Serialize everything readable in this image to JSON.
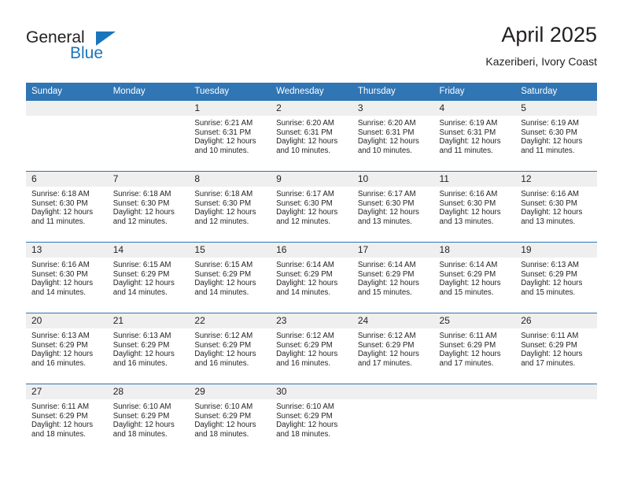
{
  "logo": {
    "word1": "General",
    "word2": "Blue",
    "shape": "triangle-mark"
  },
  "header": {
    "title": "April 2025",
    "subtitle": "Kazeriberi, Ivory Coast"
  },
  "colors": {
    "header_blue": "#3075b4",
    "logo_blue": "#1b75bb",
    "daynum_band": "#efefef",
    "text": "#231f20"
  },
  "weekdays": [
    "Sunday",
    "Monday",
    "Tuesday",
    "Wednesday",
    "Thursday",
    "Friday",
    "Saturday"
  ],
  "weeks": [
    [
      {
        "day": "",
        "lines": []
      },
      {
        "day": "",
        "lines": []
      },
      {
        "day": "1",
        "lines": [
          "Sunrise: 6:21 AM",
          "Sunset: 6:31 PM",
          "Daylight: 12 hours",
          "and 10 minutes."
        ]
      },
      {
        "day": "2",
        "lines": [
          "Sunrise: 6:20 AM",
          "Sunset: 6:31 PM",
          "Daylight: 12 hours",
          "and 10 minutes."
        ]
      },
      {
        "day": "3",
        "lines": [
          "Sunrise: 6:20 AM",
          "Sunset: 6:31 PM",
          "Daylight: 12 hours",
          "and 10 minutes."
        ]
      },
      {
        "day": "4",
        "lines": [
          "Sunrise: 6:19 AM",
          "Sunset: 6:31 PM",
          "Daylight: 12 hours",
          "and 11 minutes."
        ]
      },
      {
        "day": "5",
        "lines": [
          "Sunrise: 6:19 AM",
          "Sunset: 6:30 PM",
          "Daylight: 12 hours",
          "and 11 minutes."
        ]
      }
    ],
    [
      {
        "day": "6",
        "lines": [
          "Sunrise: 6:18 AM",
          "Sunset: 6:30 PM",
          "Daylight: 12 hours",
          "and 11 minutes."
        ]
      },
      {
        "day": "7",
        "lines": [
          "Sunrise: 6:18 AM",
          "Sunset: 6:30 PM",
          "Daylight: 12 hours",
          "and 12 minutes."
        ]
      },
      {
        "day": "8",
        "lines": [
          "Sunrise: 6:18 AM",
          "Sunset: 6:30 PM",
          "Daylight: 12 hours",
          "and 12 minutes."
        ]
      },
      {
        "day": "9",
        "lines": [
          "Sunrise: 6:17 AM",
          "Sunset: 6:30 PM",
          "Daylight: 12 hours",
          "and 12 minutes."
        ]
      },
      {
        "day": "10",
        "lines": [
          "Sunrise: 6:17 AM",
          "Sunset: 6:30 PM",
          "Daylight: 12 hours",
          "and 13 minutes."
        ]
      },
      {
        "day": "11",
        "lines": [
          "Sunrise: 6:16 AM",
          "Sunset: 6:30 PM",
          "Daylight: 12 hours",
          "and 13 minutes."
        ]
      },
      {
        "day": "12",
        "lines": [
          "Sunrise: 6:16 AM",
          "Sunset: 6:30 PM",
          "Daylight: 12 hours",
          "and 13 minutes."
        ]
      }
    ],
    [
      {
        "day": "13",
        "lines": [
          "Sunrise: 6:16 AM",
          "Sunset: 6:30 PM",
          "Daylight: 12 hours",
          "and 14 minutes."
        ]
      },
      {
        "day": "14",
        "lines": [
          "Sunrise: 6:15 AM",
          "Sunset: 6:29 PM",
          "Daylight: 12 hours",
          "and 14 minutes."
        ]
      },
      {
        "day": "15",
        "lines": [
          "Sunrise: 6:15 AM",
          "Sunset: 6:29 PM",
          "Daylight: 12 hours",
          "and 14 minutes."
        ]
      },
      {
        "day": "16",
        "lines": [
          "Sunrise: 6:14 AM",
          "Sunset: 6:29 PM",
          "Daylight: 12 hours",
          "and 14 minutes."
        ]
      },
      {
        "day": "17",
        "lines": [
          "Sunrise: 6:14 AM",
          "Sunset: 6:29 PM",
          "Daylight: 12 hours",
          "and 15 minutes."
        ]
      },
      {
        "day": "18",
        "lines": [
          "Sunrise: 6:14 AM",
          "Sunset: 6:29 PM",
          "Daylight: 12 hours",
          "and 15 minutes."
        ]
      },
      {
        "day": "19",
        "lines": [
          "Sunrise: 6:13 AM",
          "Sunset: 6:29 PM",
          "Daylight: 12 hours",
          "and 15 minutes."
        ]
      }
    ],
    [
      {
        "day": "20",
        "lines": [
          "Sunrise: 6:13 AM",
          "Sunset: 6:29 PM",
          "Daylight: 12 hours",
          "and 16 minutes."
        ]
      },
      {
        "day": "21",
        "lines": [
          "Sunrise: 6:13 AM",
          "Sunset: 6:29 PM",
          "Daylight: 12 hours",
          "and 16 minutes."
        ]
      },
      {
        "day": "22",
        "lines": [
          "Sunrise: 6:12 AM",
          "Sunset: 6:29 PM",
          "Daylight: 12 hours",
          "and 16 minutes."
        ]
      },
      {
        "day": "23",
        "lines": [
          "Sunrise: 6:12 AM",
          "Sunset: 6:29 PM",
          "Daylight: 12 hours",
          "and 16 minutes."
        ]
      },
      {
        "day": "24",
        "lines": [
          "Sunrise: 6:12 AM",
          "Sunset: 6:29 PM",
          "Daylight: 12 hours",
          "and 17 minutes."
        ]
      },
      {
        "day": "25",
        "lines": [
          "Sunrise: 6:11 AM",
          "Sunset: 6:29 PM",
          "Daylight: 12 hours",
          "and 17 minutes."
        ]
      },
      {
        "day": "26",
        "lines": [
          "Sunrise: 6:11 AM",
          "Sunset: 6:29 PM",
          "Daylight: 12 hours",
          "and 17 minutes."
        ]
      }
    ],
    [
      {
        "day": "27",
        "lines": [
          "Sunrise: 6:11 AM",
          "Sunset: 6:29 PM",
          "Daylight: 12 hours",
          "and 18 minutes."
        ]
      },
      {
        "day": "28",
        "lines": [
          "Sunrise: 6:10 AM",
          "Sunset: 6:29 PM",
          "Daylight: 12 hours",
          "and 18 minutes."
        ]
      },
      {
        "day": "29",
        "lines": [
          "Sunrise: 6:10 AM",
          "Sunset: 6:29 PM",
          "Daylight: 12 hours",
          "and 18 minutes."
        ]
      },
      {
        "day": "30",
        "lines": [
          "Sunrise: 6:10 AM",
          "Sunset: 6:29 PM",
          "Daylight: 12 hours",
          "and 18 minutes."
        ]
      },
      {
        "day": "",
        "lines": []
      },
      {
        "day": "",
        "lines": []
      },
      {
        "day": "",
        "lines": []
      }
    ]
  ]
}
